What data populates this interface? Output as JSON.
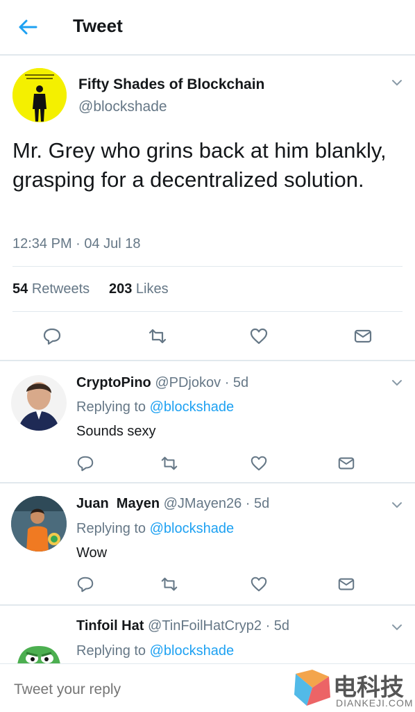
{
  "header": {
    "title": "Tweet"
  },
  "tweet": {
    "name": "Fifty Shades of Blockchain",
    "handle": "@blockshade",
    "text": "Mr. Grey who grins back at him blankly, grasping for a decentralized solution.",
    "timestamp": "12:34 PM · 04 Jul 18",
    "retweets_count": "54",
    "retweets_label": "Retweets",
    "likes_count": "203",
    "likes_label": "Likes",
    "avatar_lettering": "MR SATOSHI WILL SEE YOU NOW"
  },
  "replies": [
    {
      "name": "CryptoPino",
      "handle": "@PDjokov",
      "age": "· 5d",
      "replying_prefix": "Replying to",
      "replying_to": "@blockshade",
      "text": "Sounds sexy"
    },
    {
      "name": "Juan  Mayen",
      "handle": "@JMayen26",
      "age": "· 5d",
      "replying_prefix": "Replying to",
      "replying_to": "@blockshade",
      "text": "Wow"
    },
    {
      "name": "Tinfoil Hat",
      "handle": "@TinFoilHatCryp2",
      "age": "· 5d",
      "replying_prefix": "Replying to",
      "replying_to": "@blockshade",
      "text": ""
    }
  ],
  "composer": {
    "placeholder": "Tweet your reply"
  },
  "watermark": {
    "cn": "电科技",
    "en": "DIANKEJI.COM"
  },
  "colors": {
    "accent": "#1da1f2",
    "muted": "#657786",
    "text": "#14171a",
    "divider": "#e1e8ed"
  }
}
